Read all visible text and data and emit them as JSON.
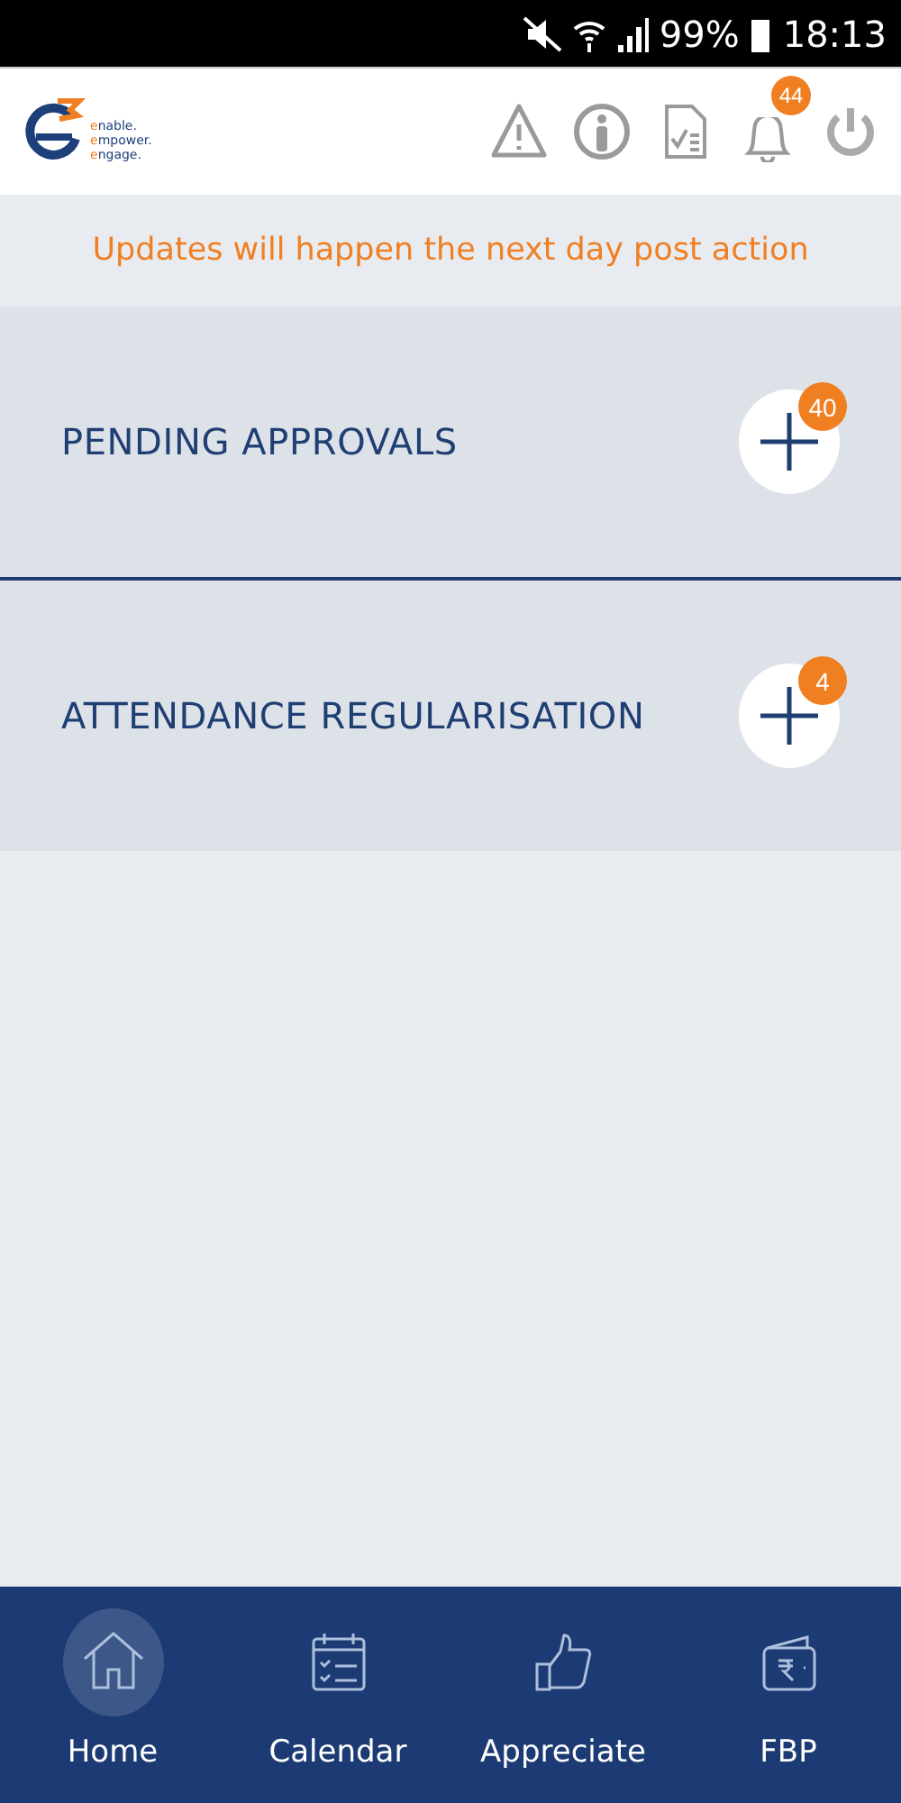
{
  "status_bar": {
    "battery": "99%",
    "time": "18:13"
  },
  "header": {
    "logo_lines": [
      "enable.",
      "empower.",
      "engage."
    ],
    "notification_count": "44"
  },
  "notice": "Updates will happen the next day post action",
  "sections": [
    {
      "title": "PENDING APPROVALS",
      "count": "40"
    },
    {
      "title": "ATTENDANCE REGULARISATION",
      "count": "4"
    }
  ],
  "bottom_nav": [
    {
      "label": "Home",
      "selected": true
    },
    {
      "label": "Calendar",
      "selected": false
    },
    {
      "label": "Appreciate",
      "selected": false
    },
    {
      "label": "FBP",
      "selected": false
    }
  ]
}
